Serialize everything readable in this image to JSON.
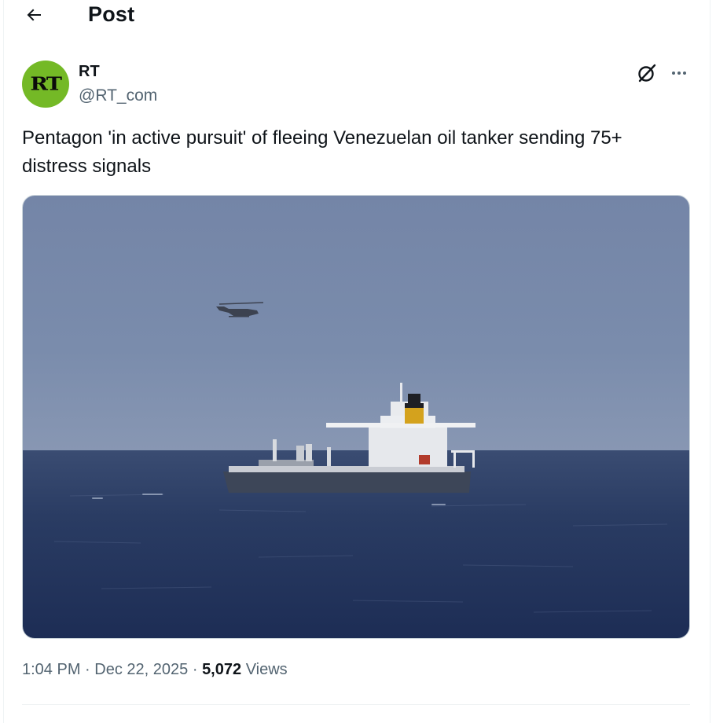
{
  "header": {
    "title": "Post",
    "back_icon": "arrow-left-icon"
  },
  "author": {
    "avatar_text": "RT",
    "avatar_color": "#74b926",
    "display_name": "RT",
    "handle": "@RT_com"
  },
  "actions": {
    "grok_icon": "grok-icon",
    "more_icon": "more-horizontal-icon"
  },
  "post": {
    "text": "Pentagon 'in active pursuit' of fleeing Venezuelan oil tanker sending 75+ distress signals"
  },
  "meta": {
    "time": "1:04 PM",
    "separator": "·",
    "date": "Dec 22, 2025",
    "views_count": "5,072",
    "views_label": "Views"
  },
  "colors": {
    "text_primary": "#0f1419",
    "text_secondary": "#536471",
    "border": "#cfd9de"
  }
}
